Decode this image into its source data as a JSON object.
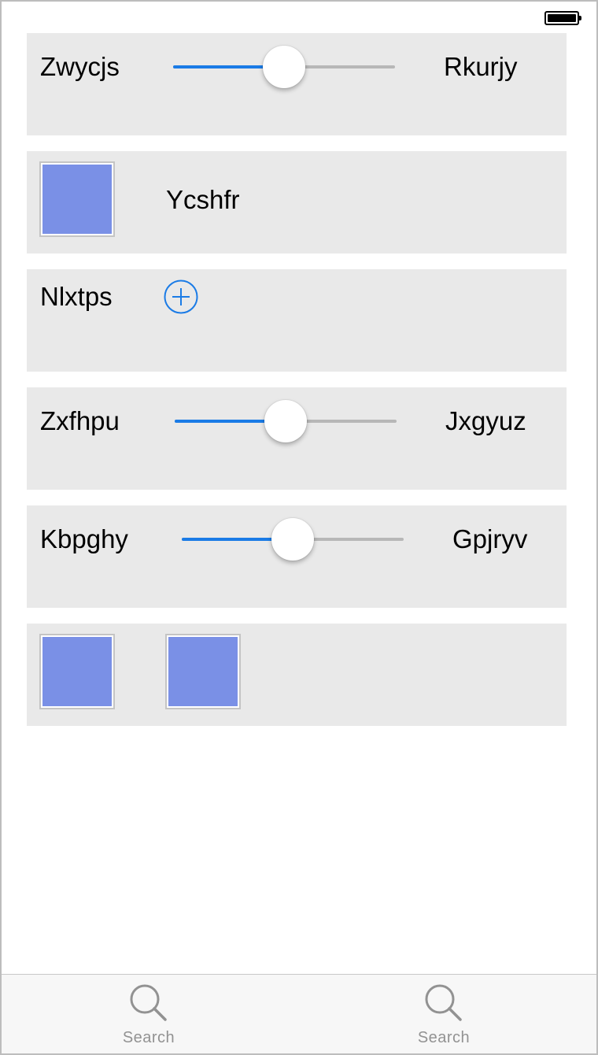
{
  "status_bar": {
    "battery_icon": "battery-full-icon"
  },
  "rows": {
    "row1": {
      "left_label": "Zwycjs",
      "right_label": "Rkurjy",
      "slider_value": 0.5
    },
    "row2": {
      "label": "Ycshfr",
      "swatch_color": "#7a90e6"
    },
    "row3": {
      "label": "Nlxtps",
      "button_icon": "plus-circle-icon",
      "accent_color": "#1a7be6"
    },
    "row4": {
      "left_label": "Zxfhpu",
      "right_label": "Jxgyuz",
      "slider_value": 0.5
    },
    "row5": {
      "left_label": "Kbpghy",
      "right_label": "Gpjryv",
      "slider_value": 0.5
    },
    "row6": {
      "swatch_colors": [
        "#7a90e6",
        "#7a90e6"
      ]
    }
  },
  "tab_bar": {
    "tabs": [
      {
        "label": "Search",
        "icon": "search-icon"
      },
      {
        "label": "Search",
        "icon": "search-icon"
      }
    ]
  },
  "colors": {
    "accent": "#1a7be6",
    "track": "#b7b7b7",
    "cell_background": "#e9e9e9",
    "tab_label": "#929292"
  }
}
